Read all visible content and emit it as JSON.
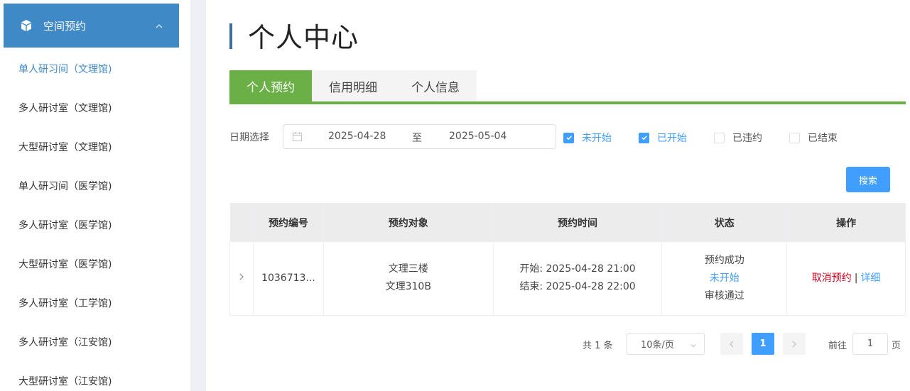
{
  "sidebar": {
    "section_title": "空间预约",
    "section_icon": "cube-icon",
    "items": [
      {
        "label": "单人研习间（文理馆)"
      },
      {
        "label": "多人研讨室（文理馆)"
      },
      {
        "label": "大型研讨室（文理馆)"
      },
      {
        "label": "单人研习间（医学馆)"
      },
      {
        "label": "多人研讨室（医学馆)"
      },
      {
        "label": "大型研讨室（医学馆)"
      },
      {
        "label": "多人研讨室（工学馆)"
      },
      {
        "label": "多人研讨室（江安馆)"
      },
      {
        "label": "大型研讨室（江安馆)"
      }
    ]
  },
  "page": {
    "title": "个人中心"
  },
  "tabs": [
    {
      "label": "个人预约"
    },
    {
      "label": "信用明细"
    },
    {
      "label": "个人信息"
    }
  ],
  "filter": {
    "date_label": "日期选择",
    "start_date": "2025-04-28",
    "separator": "至",
    "end_date": "2025-05-04",
    "checkboxes": [
      {
        "label": "未开始",
        "checked": true
      },
      {
        "label": "已开始",
        "checked": true
      },
      {
        "label": "已违约",
        "checked": false
      },
      {
        "label": "已结束",
        "checked": false
      }
    ],
    "search_label": "搜索"
  },
  "table": {
    "headers": [
      "预约编号",
      "预约对象",
      "预约时间",
      "状态",
      "操作"
    ],
    "rows": [
      {
        "id": "1036713...",
        "object_line1": "文理三楼",
        "object_line2": "文理310B",
        "time_start": "开始: 2025-04-28 21:00",
        "time_end": "结束: 2025-04-28 22:00",
        "status1": "预约成功",
        "status2": "未开始",
        "status3": "审核通过",
        "op_cancel": "取消预约",
        "op_sep": "|",
        "op_detail": "详细"
      }
    ]
  },
  "pagination": {
    "total": "共 1 条",
    "page_size": "10条/页",
    "current_page": "1",
    "goto_label": "前往",
    "goto_value": "1",
    "page_suffix": "页"
  },
  "colors": {
    "sidebar_header": "#3f89c7",
    "tab_active": "#6ab047",
    "primary": "#409eff",
    "cancel": "#d0021b"
  }
}
